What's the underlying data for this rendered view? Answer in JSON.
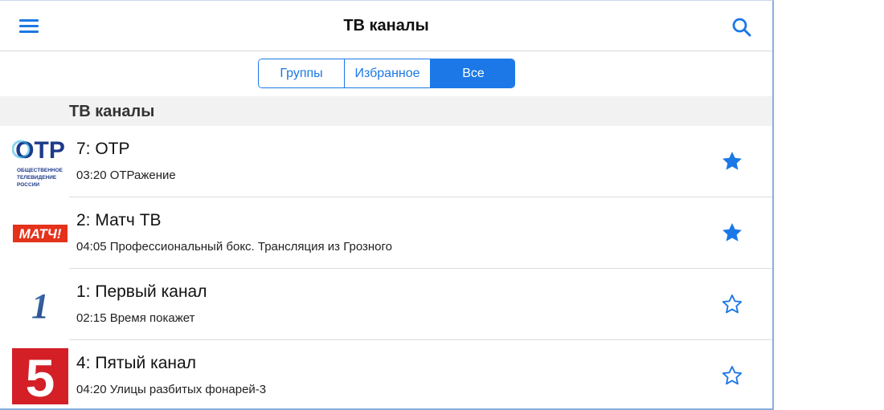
{
  "navbar": {
    "title": "ТВ каналы",
    "menu_icon": "hamburger-menu-icon",
    "search_icon": "search-icon"
  },
  "segments": [
    {
      "label": "Группы",
      "selected": false
    },
    {
      "label": "Избранное",
      "selected": false
    },
    {
      "label": "Все",
      "selected": true
    }
  ],
  "section": {
    "title": "ТВ каналы"
  },
  "channels": [
    {
      "title": "7: ОТР",
      "program": "03:20 ОТРажение",
      "logo": "otr-logo",
      "logo_text": [
        "ОТР",
        "ОБЩЕСТВЕННОЕ",
        "ТЕЛЕВИДЕНИЕ",
        "РОССИИ"
      ],
      "favorite": true
    },
    {
      "title": "2: Матч ТВ",
      "program": "04:05 Профессиональный бокс. Трансляция из Грозного",
      "logo": "match-tv-logo",
      "logo_text": [
        "МАТЧ!"
      ],
      "favorite": true
    },
    {
      "title": "1: Первый канал",
      "program": "02:15 Время покажет",
      "logo": "perviy-kanal-logo",
      "logo_text": [
        "1"
      ],
      "favorite": false
    },
    {
      "title": "4: Пятый канал",
      "program": "04:20 Улицы разбитых фонарей-3",
      "logo": "pyatyy-kanal-logo",
      "logo_text": [
        "5"
      ],
      "favorite": false
    }
  ],
  "colors": {
    "accent": "#1b78e6",
    "section_bg": "#f2f2f2",
    "separator": "#dcdcdc",
    "match_red": "#e4321b",
    "five_red": "#d41f26",
    "otr_blue": "#1e3a8a"
  }
}
